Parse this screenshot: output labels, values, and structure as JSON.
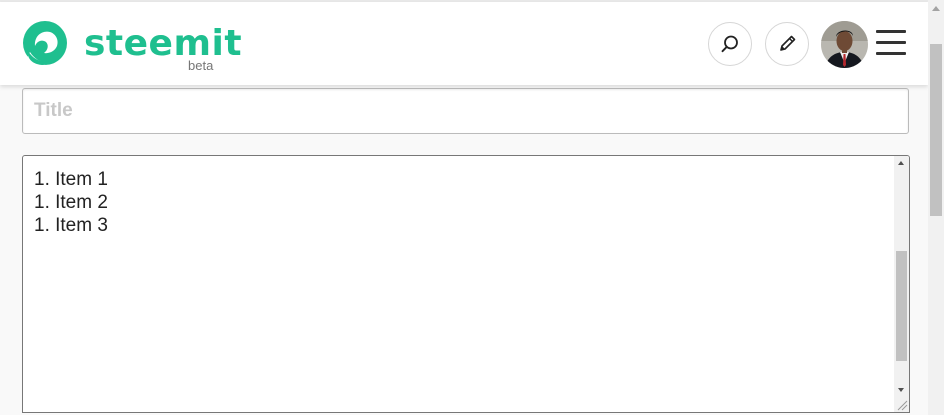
{
  "header": {
    "brand": "steemit",
    "badge": "beta",
    "brand_color": "#1fbf8f",
    "icons": [
      "steemit-logo-icon",
      "search-icon",
      "pencil-icon",
      "avatar",
      "hamburger-menu-icon"
    ]
  },
  "editor": {
    "title_placeholder": "Title",
    "title_value": "",
    "body_lines": [
      "1. Item 1",
      "1. Item 2",
      "1. Item 3"
    ]
  }
}
